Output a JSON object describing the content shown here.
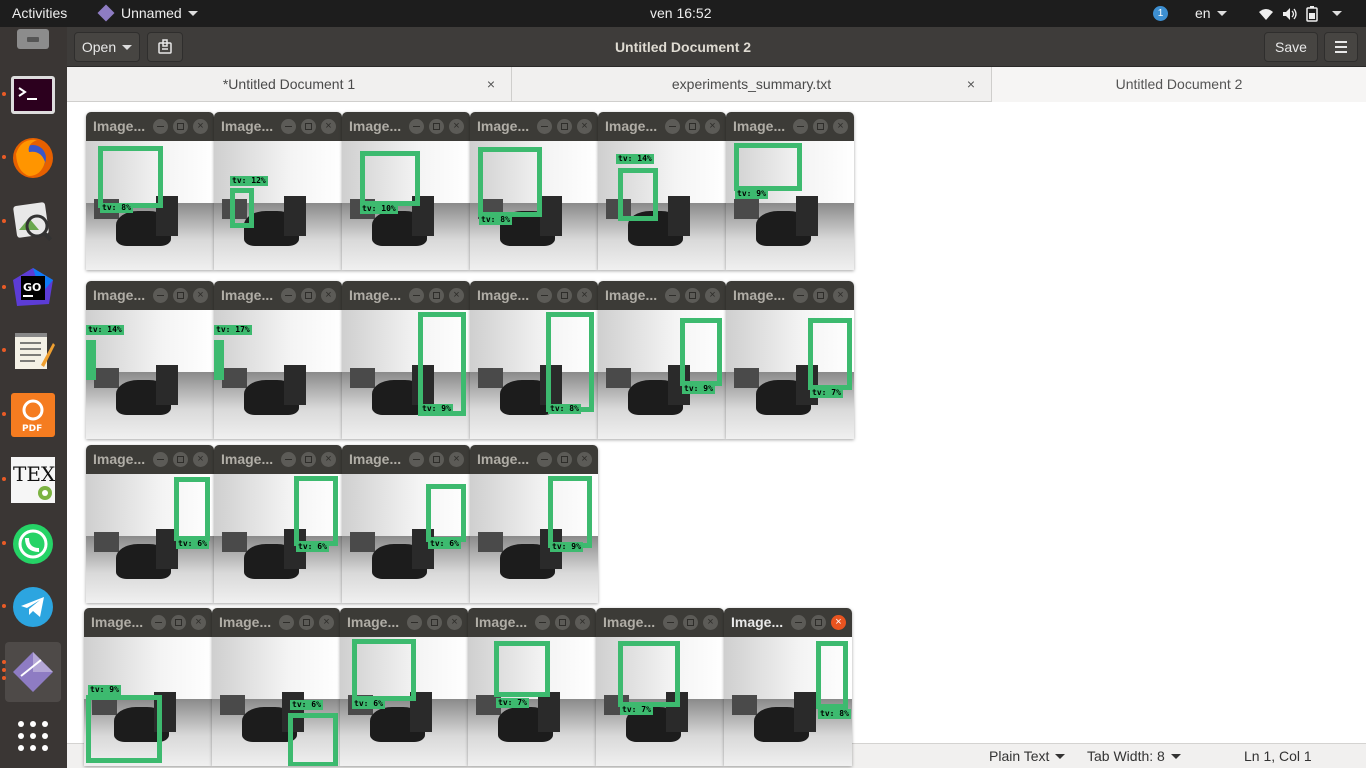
{
  "topbar": {
    "activities": "Activities",
    "app_name": "Unnamed",
    "clock": "ven 16:52",
    "notification_count": "1",
    "language": "en"
  },
  "dock": {
    "items": [
      "files",
      "terminal",
      "firefox",
      "image-viewer",
      "goland",
      "text-editor",
      "pdf-editor",
      "texstudio",
      "whatsapp",
      "telegram",
      "unnamed-app",
      "show-applications"
    ]
  },
  "gedit": {
    "open_label": "Open",
    "title": "Untitled Document 2",
    "save_label": "Save",
    "tabs": [
      {
        "label": "*Untitled Document 1",
        "closable": true
      },
      {
        "label": "experiments_summary.txt",
        "closable": true
      },
      {
        "label": "Untitled Document 2",
        "closable": false
      }
    ],
    "close_glyph": "×",
    "status": {
      "language": "Plain Text",
      "tab_width": "Tab Width: 8",
      "position": "Ln 1, Col 1"
    }
  },
  "image_windows": {
    "title": "Image...",
    "close_glyph": "×",
    "rows": [
      [
        {
          "label": "tv: 8%"
        },
        {
          "label": "tv: 12%"
        },
        {
          "label": "tv: 10%"
        },
        {
          "label": "tv: 8%"
        },
        {
          "label": "tv: 14%"
        },
        {
          "label": "tv: 9%"
        }
      ],
      [
        {
          "label": "tv: 14%"
        },
        {
          "label": "tv: 17%"
        },
        {
          "label": "tv: 9%"
        },
        {
          "label": "tv: 8%"
        },
        {
          "label": "tv: 9%"
        },
        {
          "label": "tv: 7%"
        }
      ],
      [
        {
          "label": "tv: 6%"
        },
        {
          "label": "tv: 6%"
        },
        {
          "label": "tv: 6%"
        },
        {
          "label": "tv: 9%"
        }
      ],
      [
        {
          "label": "tv: 9%"
        },
        {
          "label": "tv: 6%"
        },
        {
          "label": "tv: 6%"
        },
        {
          "label": "tv: 7%"
        },
        {
          "label": "tv: 7%"
        },
        {
          "label": "tv: 8%"
        }
      ]
    ]
  }
}
